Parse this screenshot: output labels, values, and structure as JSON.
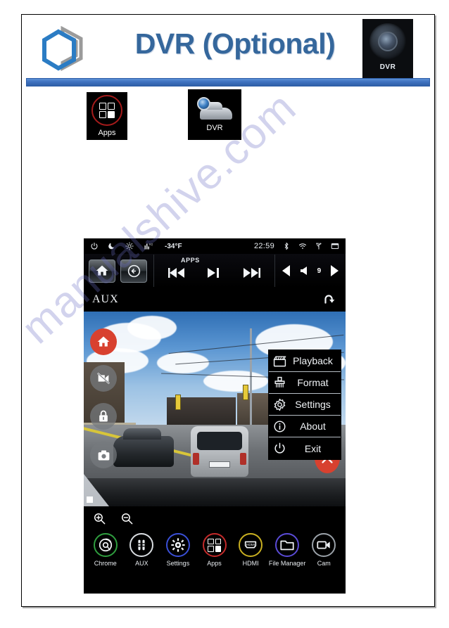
{
  "document": {
    "title": "DVR (Optional)",
    "watermark": "manualshive.com",
    "header_icon": {
      "name": "dvr-lens-icon",
      "caption": "DVR"
    }
  },
  "launcher_tiles": [
    {
      "name": "apps-tile",
      "caption": "Apps",
      "icon": "apps-grid-icon"
    },
    {
      "name": "dvr-tile",
      "caption": "DVR",
      "icon": "dvr-car-camera-icon"
    }
  ],
  "head_unit": {
    "status_bar": {
      "left_icons": [
        "power-icon",
        "night-mode-icon",
        "brightness-icon",
        "equalizer-icon"
      ],
      "temperature": "-34°F",
      "clock": "22:59",
      "right_icons": [
        "bluetooth-icon",
        "wifi-icon",
        "usb-icon",
        "recents-icon"
      ]
    },
    "media_bar": {
      "home_label": "home-button",
      "back_label": "back-button",
      "source_label": "APPS",
      "transport": [
        "previous-track",
        "play-pause",
        "next-track"
      ],
      "volume": {
        "down": "volume-down",
        "level": "9",
        "up": "volume-up",
        "icon": "speaker-icon"
      }
    },
    "source_bar": {
      "title": "AUX",
      "back_icon": "return-arrow-icon"
    },
    "video": {
      "side_buttons": [
        {
          "name": "dvr-home-button",
          "icon": "home-icon",
          "style": "red"
        },
        {
          "name": "dvr-record-toggle-button",
          "icon": "video-off-icon",
          "style": "grey"
        },
        {
          "name": "dvr-lock-button",
          "icon": "lock-icon",
          "style": "grey"
        },
        {
          "name": "dvr-snapshot-button",
          "icon": "camera-icon",
          "style": "grey"
        }
      ],
      "close_button": {
        "name": "dvr-close-button",
        "icon": "close-x-icon"
      },
      "menu": [
        {
          "label": "Playback",
          "icon": "clapperboard-icon"
        },
        {
          "label": "Format",
          "icon": "brush-icon"
        },
        {
          "label": "Settings",
          "icon": "gear-icon"
        },
        {
          "label": "About",
          "icon": "info-icon"
        },
        {
          "label": "Exit",
          "icon": "power-icon"
        }
      ]
    },
    "zoom_controls": [
      {
        "name": "zoom-in-button",
        "icon": "magnifier-plus-icon"
      },
      {
        "name": "zoom-out-button",
        "icon": "magnifier-minus-icon"
      }
    ],
    "dock": [
      {
        "label": "Chrome",
        "icon": "chrome-icon",
        "color": "#2f9e3f"
      },
      {
        "label": "AUX",
        "icon": "aux-plug-icon",
        "color": "#d9dde1"
      },
      {
        "label": "Settings",
        "icon": "gear-icon",
        "color": "#3a4fd6"
      },
      {
        "label": "Apps",
        "icon": "apps-grid-icon",
        "color": "#c32a2a"
      },
      {
        "label": "HDMI",
        "icon": "hdmi-icon",
        "color": "#c9b021"
      },
      {
        "label": "File Manager",
        "icon": "folder-icon",
        "color": "#5a4bd6"
      },
      {
        "label": "Cam",
        "icon": "camcorder-icon",
        "color": "#9aa1a8"
      }
    ]
  },
  "colors": {
    "title_blue": "#35679c",
    "rule_blue": "#3f72bf",
    "accent_red": "#d8412f",
    "panel_black": "#000000"
  }
}
